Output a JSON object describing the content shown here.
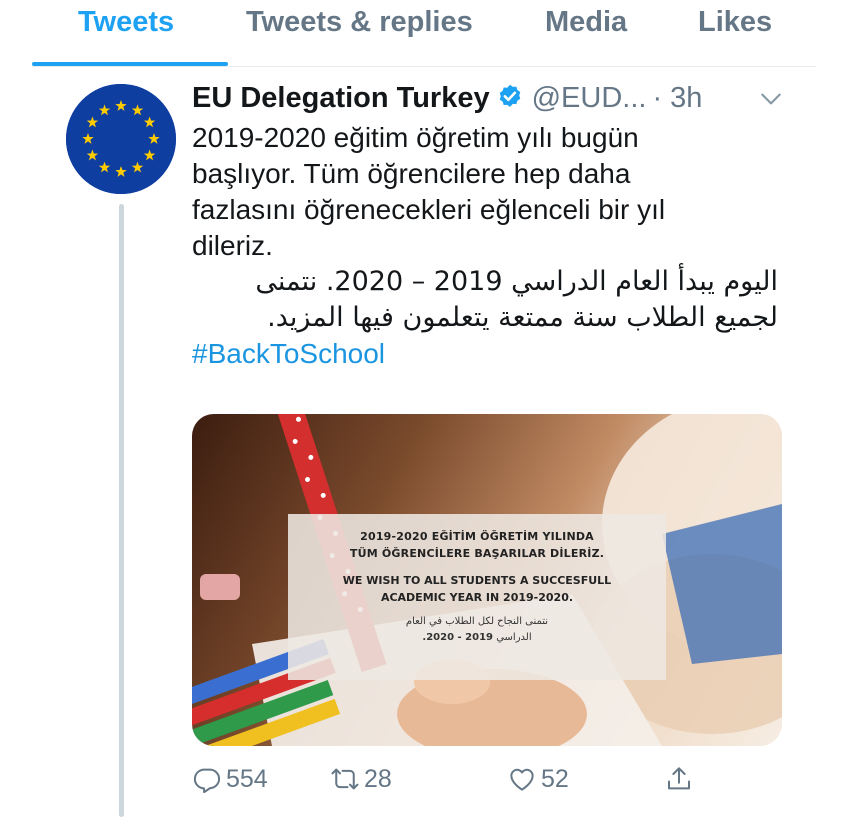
{
  "tabs": [
    {
      "label": "Tweets",
      "active": true
    },
    {
      "label": "Tweets & replies",
      "active": false
    },
    {
      "label": "Media",
      "active": false
    },
    {
      "label": "Likes",
      "active": false
    }
  ],
  "tweet": {
    "author_name": "EU Delegation Turkey",
    "verified": true,
    "handle": "@EUD...",
    "time": "· 3h",
    "text_tr_lines": [
      "2019-2020 eğitim öğretim yılı bugün",
      "başlıyor. Tüm öğrencilere hep daha",
      "fazlasını öğrenecekleri eğlenceli bir yıl",
      "dileriz."
    ],
    "text_ar_lines": [
      "اليوم يبدأ العام الدراسي 2019 – 2020. نتمنى",
      "لجميع الطلاب سنة ممتعة يتعلمون فيها المزيد."
    ],
    "hashtag": "#BackToSchool",
    "media": {
      "overlay_tr_1": "2019-2020 EĞİTİM ÖĞRETİM YILINDA",
      "overlay_tr_2": "TÜM ÖĞRENCİLERE BAŞARILAR DİLERİZ.",
      "overlay_en_1": "WE WISH TO ALL STUDENTS A SUCCESFULL",
      "overlay_en_2": "ACADEMIC YEAR IN 2019-2020.",
      "overlay_ar_1": "نتمنى النجاح لكل الطلاب في العام",
      "overlay_ar_2": "الدراسي",
      "overlay_ar_year": "2019 - 2020."
    },
    "actions": {
      "reply_count": "554",
      "retweet_count": "28",
      "like_count": "52"
    }
  },
  "icons": {
    "verified": "verified-badge-icon",
    "caret": "chevron-down-icon",
    "reply": "reply-icon",
    "retweet": "retweet-icon",
    "like": "heart-icon",
    "share": "share-icon"
  },
  "colors": {
    "accent": "#1da1f2",
    "muted": "#657786",
    "text": "#14171a",
    "link": "#1b95e0",
    "eu_blue": "#0f3ea1",
    "eu_star": "#ffcc00"
  }
}
